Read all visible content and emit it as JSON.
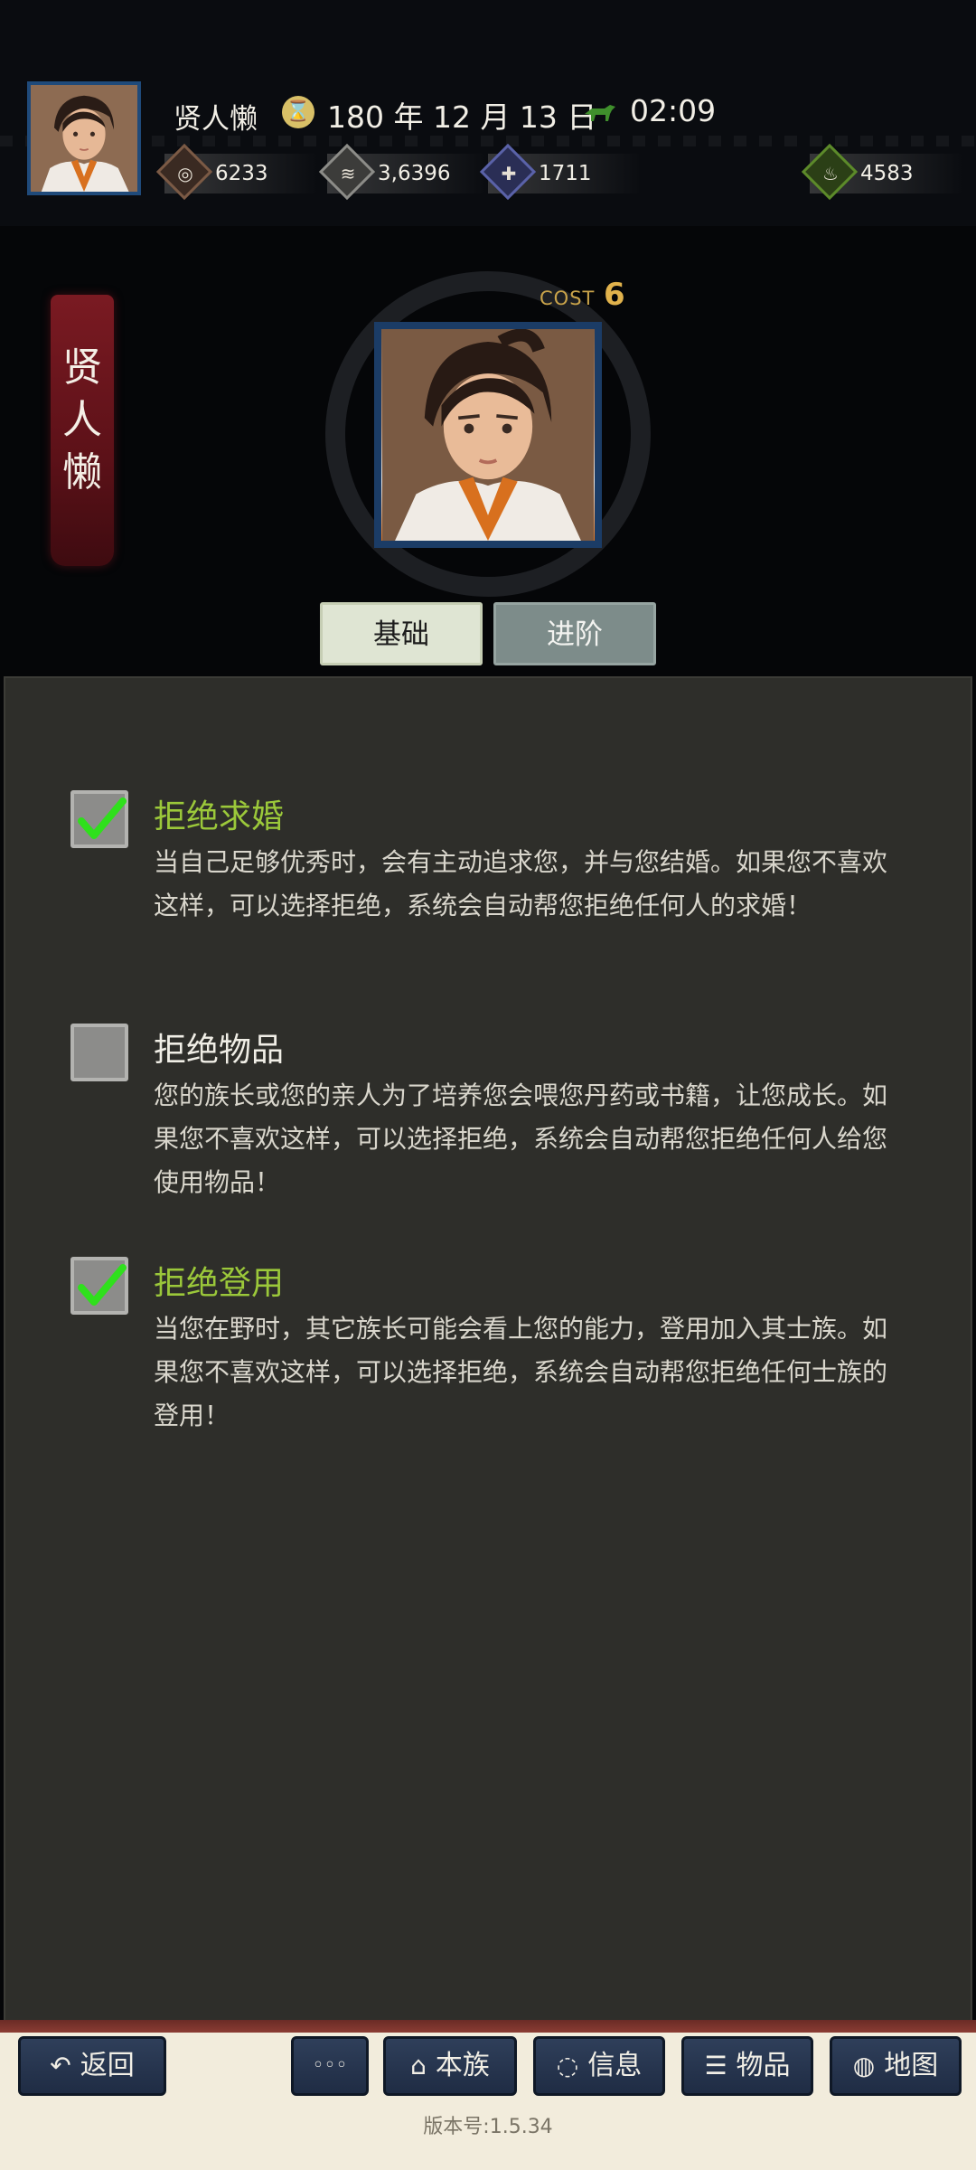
{
  "header": {
    "player_name": "贤人懒",
    "date_icon": "calendar-icon",
    "date": "180 年 12 月 13 日",
    "time_icon": "horse-icon",
    "time": "02:09",
    "resources": [
      {
        "icon": "coin-icon",
        "value": "6233",
        "color": "#7b5a45"
      },
      {
        "icon": "grain-icon",
        "value": "3,6396",
        "color": "#8c8c88"
      },
      {
        "icon": "soldier-icon",
        "value": "1711",
        "color": "#5a62a8"
      },
      {
        "icon": "bag-icon",
        "value": "4583",
        "color": "#5c8a2a"
      }
    ]
  },
  "hero": {
    "banner_name": "贤人懒",
    "cost_label": "COST",
    "cost_value": "6"
  },
  "tabs": {
    "basic": "基础",
    "advanced": "进阶"
  },
  "options": [
    {
      "checked": true,
      "title": "拒绝求婚",
      "desc": "当自己足够优秀时，会有主动追求您，并与您结婚。如果您不喜欢这样，可以选择拒绝，系统会自动帮您拒绝任何人的求婚！"
    },
    {
      "checked": false,
      "title": "拒绝物品",
      "desc": "您的族长或您的亲人为了培养您会喂您丹药或书籍，让您成长。如果您不喜欢这样，可以选择拒绝，系统会自动帮您拒绝任何人给您使用物品！"
    },
    {
      "checked": true,
      "title": "拒绝登用",
      "desc": "当您在野时，其它族长可能会看上您的能力，登用加入其士族。如果您不喜欢这样，可以选择拒绝，系统会自动帮您拒绝任何士族的登用！"
    }
  ],
  "bottom_nav": {
    "back": {
      "icon": "back-arrow-icon",
      "label": "返回"
    },
    "more": {
      "icon": "more-icon",
      "label": "◦◦◦"
    },
    "clan": {
      "icon": "clan-icon",
      "label": "本族"
    },
    "info": {
      "icon": "chat-icon",
      "label": "信息"
    },
    "items": {
      "icon": "items-icon",
      "label": "物品"
    },
    "map": {
      "icon": "globe-icon",
      "label": "地图"
    }
  },
  "version": "版本号:1.5.34",
  "colors": {
    "accent_green": "#9bc83a",
    "panel_bg": "#2e2e2a",
    "nav_blue": "#2f3f5a"
  }
}
